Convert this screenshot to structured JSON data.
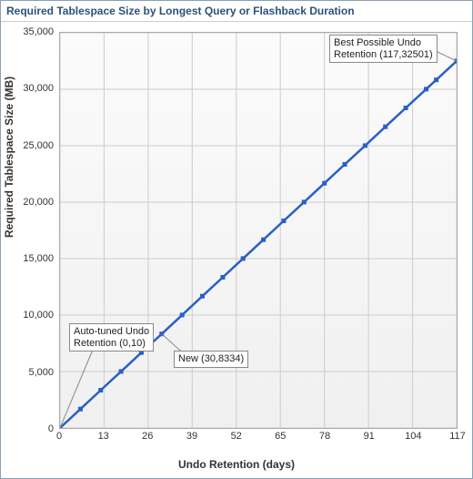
{
  "title": "Required Tablespace Size by Longest Query or Flashback Duration",
  "ylabel": "Required Tablespace Size (MB)",
  "xlabel": "Undo Retention (days)",
  "yticks": [
    "0",
    "5,000",
    "10,000",
    "15,000",
    "20,000",
    "25,000",
    "30,000",
    "35,000"
  ],
  "xticks": [
    "0",
    "13",
    "26",
    "39",
    "52",
    "65",
    "78",
    "91",
    "104",
    "117"
  ],
  "annot_auto_l1": "Auto-tuned Undo",
  "annot_auto_l2": "Retention (0,10)",
  "annot_new": "New (30,8334)",
  "annot_best_l1": "Best Possible Undo",
  "annot_best_l2": "Retention (117,32501)",
  "chart_data": {
    "type": "line",
    "title": "Required Tablespace Size by Longest Query or Flashback Duration",
    "xlabel": "Undo Retention (days)",
    "ylabel": "Required Tablespace Size (MB)",
    "xlim": [
      0,
      117
    ],
    "ylim": [
      0,
      35000
    ],
    "x": [
      0,
      6,
      12,
      18,
      24,
      30,
      36,
      42,
      48,
      54,
      60,
      66,
      72,
      78,
      84,
      90,
      96,
      102,
      108,
      111,
      117
    ],
    "values": [
      10,
      1677,
      3344,
      5010,
      6677,
      8334,
      10010,
      11677,
      13344,
      15010,
      16677,
      18344,
      20010,
      21677,
      23344,
      25010,
      26677,
      28344,
      30010,
      30834,
      32501
    ],
    "annotations": [
      {
        "label": "Auto-tuned Undo Retention",
        "x": 0,
        "y": 10
      },
      {
        "label": "New",
        "x": 30,
        "y": 8334
      },
      {
        "label": "Best Possible Undo Retention",
        "x": 117,
        "y": 32501
      }
    ]
  }
}
